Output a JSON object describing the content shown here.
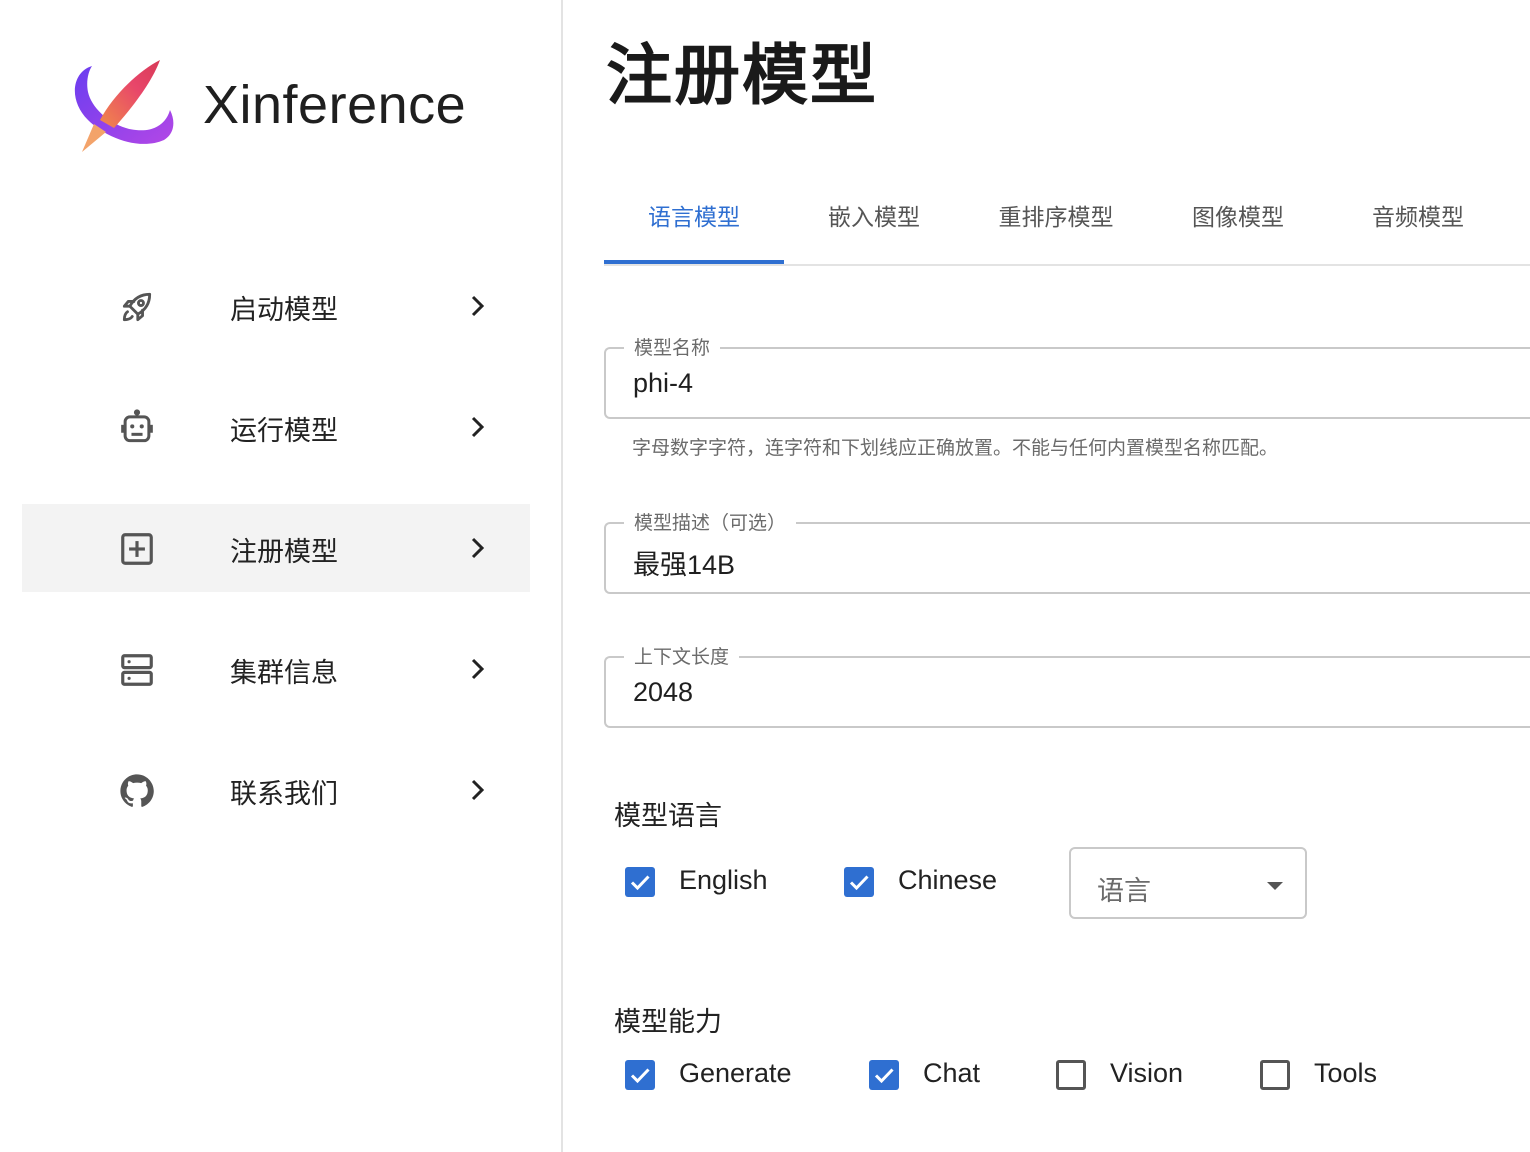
{
  "app": {
    "brand": "Xinference"
  },
  "sidebar": {
    "items": [
      {
        "label": "启动模型",
        "icon": "rocket-icon",
        "active": false
      },
      {
        "label": "运行模型",
        "icon": "robot-icon",
        "active": false
      },
      {
        "label": "注册模型",
        "icon": "add-box-icon",
        "active": true
      },
      {
        "label": "集群信息",
        "icon": "server-icon",
        "active": false
      },
      {
        "label": "联系我们",
        "icon": "github-icon",
        "active": false
      }
    ]
  },
  "page": {
    "title": "注册模型"
  },
  "tabs": [
    {
      "label": "语言模型",
      "active": true
    },
    {
      "label": "嵌入模型",
      "active": false
    },
    {
      "label": "重排序模型",
      "active": false
    },
    {
      "label": "图像模型",
      "active": false
    },
    {
      "label": "音频模型",
      "active": false
    }
  ],
  "form": {
    "model_name": {
      "label": "模型名称",
      "value": "phi-4",
      "helper": "字母数字字符，连字符和下划线应正确放置。不能与任何内置模型名称匹配。"
    },
    "model_description": {
      "label": "模型描述（可选）",
      "value": "最强14B"
    },
    "context_length": {
      "label": "上下文长度",
      "value": "2048"
    },
    "languages": {
      "title": "模型语言",
      "options": [
        {
          "label": "English",
          "checked": true
        },
        {
          "label": "Chinese",
          "checked": true
        }
      ],
      "select_placeholder": "语言"
    },
    "abilities": {
      "title": "模型能力",
      "options": [
        {
          "label": "Generate",
          "checked": true
        },
        {
          "label": "Chat",
          "checked": true
        },
        {
          "label": "Vision",
          "checked": false
        },
        {
          "label": "Tools",
          "checked": false
        }
      ]
    }
  },
  "colors": {
    "accent": "#2f6fd1",
    "active_nav_bg": "#f3f3f3"
  }
}
